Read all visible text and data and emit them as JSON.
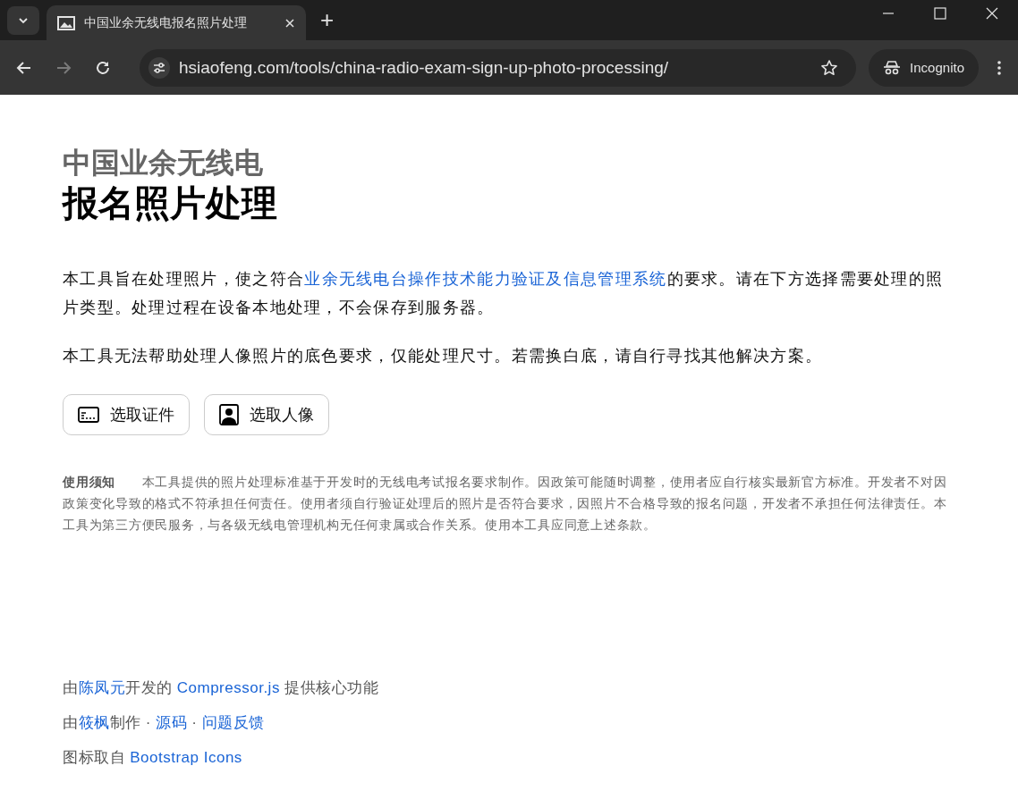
{
  "browser": {
    "tab": {
      "title": "中国业余无线电报名照片处理",
      "selected": true
    },
    "new_tab": "+",
    "url": "hsiaofeng.com/tools/china-radio-exam-sign-up-photo-processing/",
    "profile": "Incognito"
  },
  "header": {
    "subtitle": "中国业余无线电",
    "title": "报名照片处理"
  },
  "intro": [
    {
      "text": "本工具旨在处理照片，使之符合",
      "link": false
    },
    {
      "text": "业余无线电台操作技术能力验证及信息管理系统",
      "link": true
    },
    {
      "text": "的要求。请在下方选择需要处理的照片类型。处理过程在设备本地处理，不会保存到服务器。",
      "link": false
    }
  ],
  "note": "本工具无法帮助处理人像照片的底色要求，仅能处理尺寸。若需换白底，请自行寻找其他解决方案。",
  "buttons": [
    {
      "kind": "id-card",
      "label": "选取证件"
    },
    {
      "kind": "portrait",
      "label": "选取人像"
    }
  ],
  "notice": "**使用须知**　　本工具提供的照片处理标准基于开发时的无线电考试报名要求制作。因政策可能随时调整，使用者应自行核实最新官方标准。开发者不对因政策变化导致的格式不符承担任何责任。使用者须自行验证处理后的照片是否符合要求，因照片不合格导致的报名问题，开发者不承担任何法律责任。本工具为第三方便民服务，与各级无线电管理机构无任何隶属或合作关系。使用本工具应同意上述条款。",
  "footer": [
    [
      {
        "text": "由",
        "link": false
      },
      {
        "text": "陈凤元",
        "link": true
      },
      {
        "text": "开发的 ",
        "link": false
      },
      {
        "text": "Compressor.js",
        "link": true
      },
      {
        "text": " 提供核心功能",
        "link": false
      }
    ],
    [
      {
        "text": "由",
        "link": false
      },
      {
        "text": "筱枫",
        "link": true
      },
      {
        "text": "制作 · ",
        "link": false
      },
      {
        "text": "源码",
        "link": true
      },
      {
        "text": " · ",
        "link": false
      },
      {
        "text": "问题反馈",
        "link": true
      }
    ],
    [
      {
        "text": "图标取自 ",
        "link": false
      },
      {
        "text": "Bootstrap Icons",
        "link": true
      }
    ]
  ]
}
